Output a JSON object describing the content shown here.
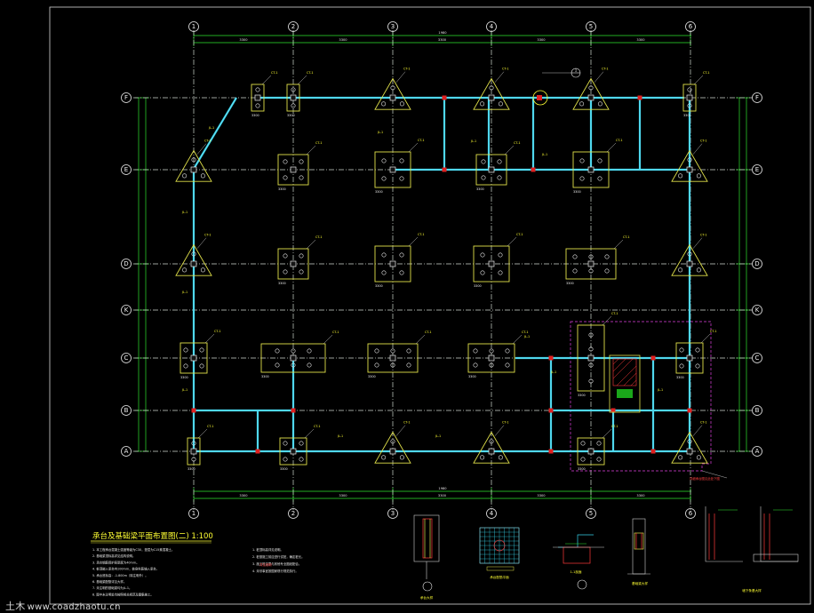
{
  "drawing": {
    "title": "承台及基础梁平面布置图(二) 1:100",
    "axes_x": [
      "1",
      "2",
      "3",
      "4",
      "5",
      "6"
    ],
    "axes_y": [
      "F",
      "E",
      "D",
      "K",
      "C",
      "B",
      "A"
    ],
    "total_dim_label": "1980",
    "bay_dim_label": "3300",
    "cap_label": "CT-1",
    "beam_label": "JL-1",
    "section_marker": "1",
    "legend_note": "详细承台图见此处下图"
  },
  "notes": {
    "left": [
      "1. 本工程承台混凝土强度等级为C30，垫层为C15素混凝土。",
      "2. 基础梁顶标高详见结构说明。",
      "3. 承台钢筋保护层厚度为40mm。",
      "4. 桩顶嵌入承台内100mm，桩身纵筋锚入承台。",
      "5. 承台底标高：-1.800m（除注明外）。",
      "6. 基础梁配筋详见大样。",
      "7. 未注明的基础梁均为JL-1。",
      "8. 图中未注明处均按照相关规范及图集施工。"
    ],
    "right": [
      "1. 桩顶标高详见说明。",
      "2. 桩基施工前应进行试桩，确定桩长。",
      "3. 施工时注意与其他专业图纸配合。",
      "4. 未尽事宜按国家现行规范执行。"
    ],
    "right_red": "详见说明"
  },
  "details": {
    "d1_label": "承台大样",
    "d2_label": "承台配筋平面",
    "d3_label": "1-1剖面",
    "d4_label": "基础梁大样",
    "d5_label": "墙下条基大样"
  },
  "watermark": {
    "cn": "土木",
    "site": "www.coadzhaotu.cn"
  }
}
